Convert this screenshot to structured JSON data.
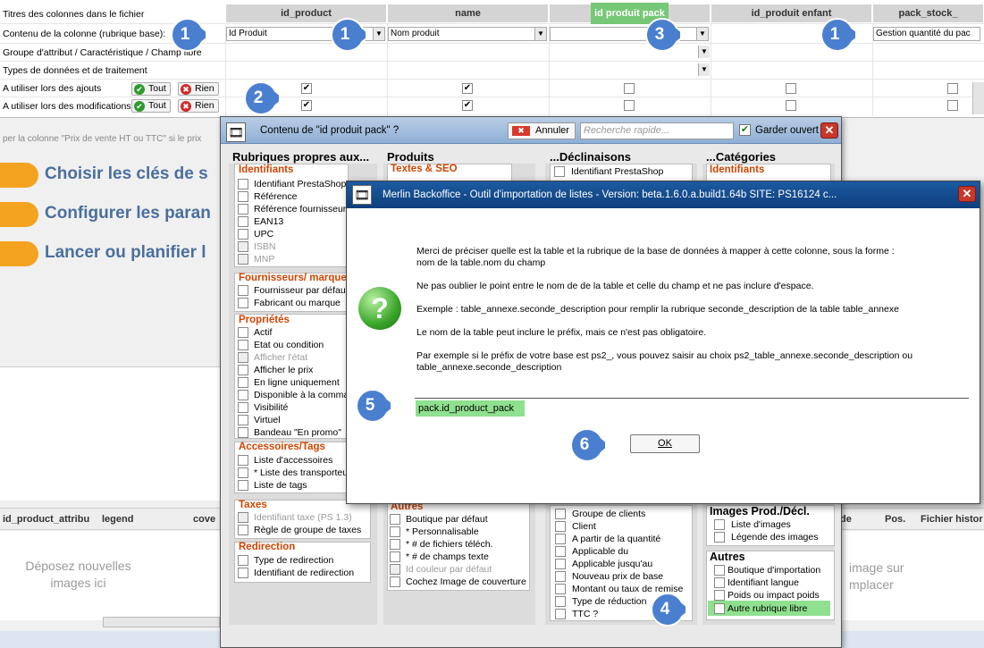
{
  "grid": {
    "row_labels": [
      "Titres des colonnes dans le fichier",
      "Contenu de la colonne (rubrique base):",
      "Groupe d'attribut / Caractéristique / Champ libre",
      "Types de données et de traitement",
      "A utiliser lors des ajouts",
      "A utiliser lors des modifications"
    ],
    "columns": [
      "id_product",
      "name",
      "id produit pack",
      "id_produit enfant",
      "pack_stock_"
    ],
    "contents": [
      "Id Produit",
      "Nom produit",
      "",
      "",
      "Gestion quantité du pac"
    ],
    "tout_label": "Tout",
    "rien_label": "Rien",
    "hint_text": "per la colonne \"Prix de vente HT ou TTC\" si le prix"
  },
  "steps": [
    {
      "label": "Choisir les clés de s"
    },
    {
      "label": "Configurer les paran"
    },
    {
      "label": "Lancer ou planifier l"
    }
  ],
  "badges": [
    "1",
    "1",
    "3",
    "1",
    "2",
    "4",
    "5",
    "6"
  ],
  "bottom_grid": {
    "headers": [
      "id_product_attribu",
      "legend",
      "cove",
      "de",
      "Pos.",
      "Fichier histor"
    ],
    "drop_left": "Déposez nouvelles images ici",
    "drop_right": "image sur mplacer"
  },
  "dialog1": {
    "title": "Contenu de \"id produit pack\" ?",
    "annuler": "Annuler",
    "search_placeholder": "Recherche rapide...",
    "keep_open": "Garder ouvert",
    "col_heads": [
      "Rubriques propres aux...",
      "Produits",
      "...Déclinaisons",
      "...Catégories"
    ],
    "groups": {
      "identifiants": {
        "title": "Identifiants",
        "items": [
          "Identifiant PrestaShop",
          "Référence",
          "Référence fournisseur",
          "EAN13",
          "UPC",
          "ISBN",
          "MNP"
        ]
      },
      "fournisseurs": {
        "title": "Fournisseurs/ marque",
        "items": [
          "Fournisseur par défaut",
          "Fabricant ou marque"
        ]
      },
      "proprietes": {
        "title": "Propriétés",
        "items": [
          "Actif",
          "Etat ou condition",
          "Afficher l'état",
          "Afficher le prix",
          "En ligne uniquement",
          "Disponible à la comma",
          "Visibilité",
          "Virtuel",
          "Bandeau \"En promo\""
        ]
      },
      "accessoires": {
        "title": "Accessoires/Tags",
        "items": [
          "Liste d'accessoires",
          "* Liste des transporteu",
          "Liste de tags"
        ]
      },
      "taxes": {
        "title": "Taxes",
        "items": [
          "Identifiant taxe (PS 1.3)",
          "Règle de groupe de taxes"
        ]
      },
      "redirection": {
        "title": "Redirection",
        "items": [
          "Type de redirection",
          "Identifiant de redirection"
        ]
      },
      "textes": {
        "title": "Textes & SEO"
      },
      "autres_produits": {
        "title": "Autres",
        "items": [
          "Boutique par défaut",
          "* Personnalisable",
          "* # de fichiers téléch.",
          "* # de champs texte",
          "Id couleur par défaut",
          "Cochez Image de couverture"
        ]
      },
      "declinaisons": {
        "items": [
          "Identifiant PrestaShop"
        ]
      },
      "prix_spec": {
        "items": [
          "Groupe de clients",
          "Client",
          "A partir de la quantité",
          "Applicable du",
          "Applicable jusqu'au",
          "Nouveau prix de base",
          "Montant ou taux de remise",
          "Type de réduction",
          "TTC ?"
        ]
      },
      "categories": {
        "title": "Identifiants"
      },
      "images": {
        "title": "Images Prod./Décl.",
        "items": [
          "Liste d'images",
          "Légende des images"
        ]
      },
      "autres": {
        "title": "Autres",
        "items": [
          "Boutique d'importation",
          "Identifiant langue",
          "Poids ou impact poids",
          "Autre rubrique libre"
        ]
      }
    }
  },
  "dialog2": {
    "title": "Merlin Backoffice - Outil d'importation de listes  -  Version:  beta.1.6.0.a.build1.64b    SITE: PS16124 c...",
    "lines": [
      "Merci de préciser quelle est la table et la rubrique de la base de données à mapper à cette colonne, sous la forme :",
      "nom de la table.nom du champ",
      "Ne pas oublier le point entre le nom de de la table et celle du champ et ne pas inclure d'espace.",
      "Exemple :  table_annexe.seconde_description  pour remplir la rubrique seconde_description de la table table_annexe",
      "Le nom de la table peut inclure le préfix, mais ce n'est pas obligatoire.",
      "Par exemple si le préfix de votre base est ps2_, vous pouvez saisir au choix ps2_table_annexe.seconde_description ou",
      "table_annexe.seconde_description"
    ],
    "input_value": "pack.id_product_pack",
    "ok_label": "OK"
  },
  "colors": {
    "accent_green": "#8fe08f",
    "badge_blue": "#4a7fd0",
    "step_orange": "#f4a320",
    "group_title": "#d04500"
  }
}
